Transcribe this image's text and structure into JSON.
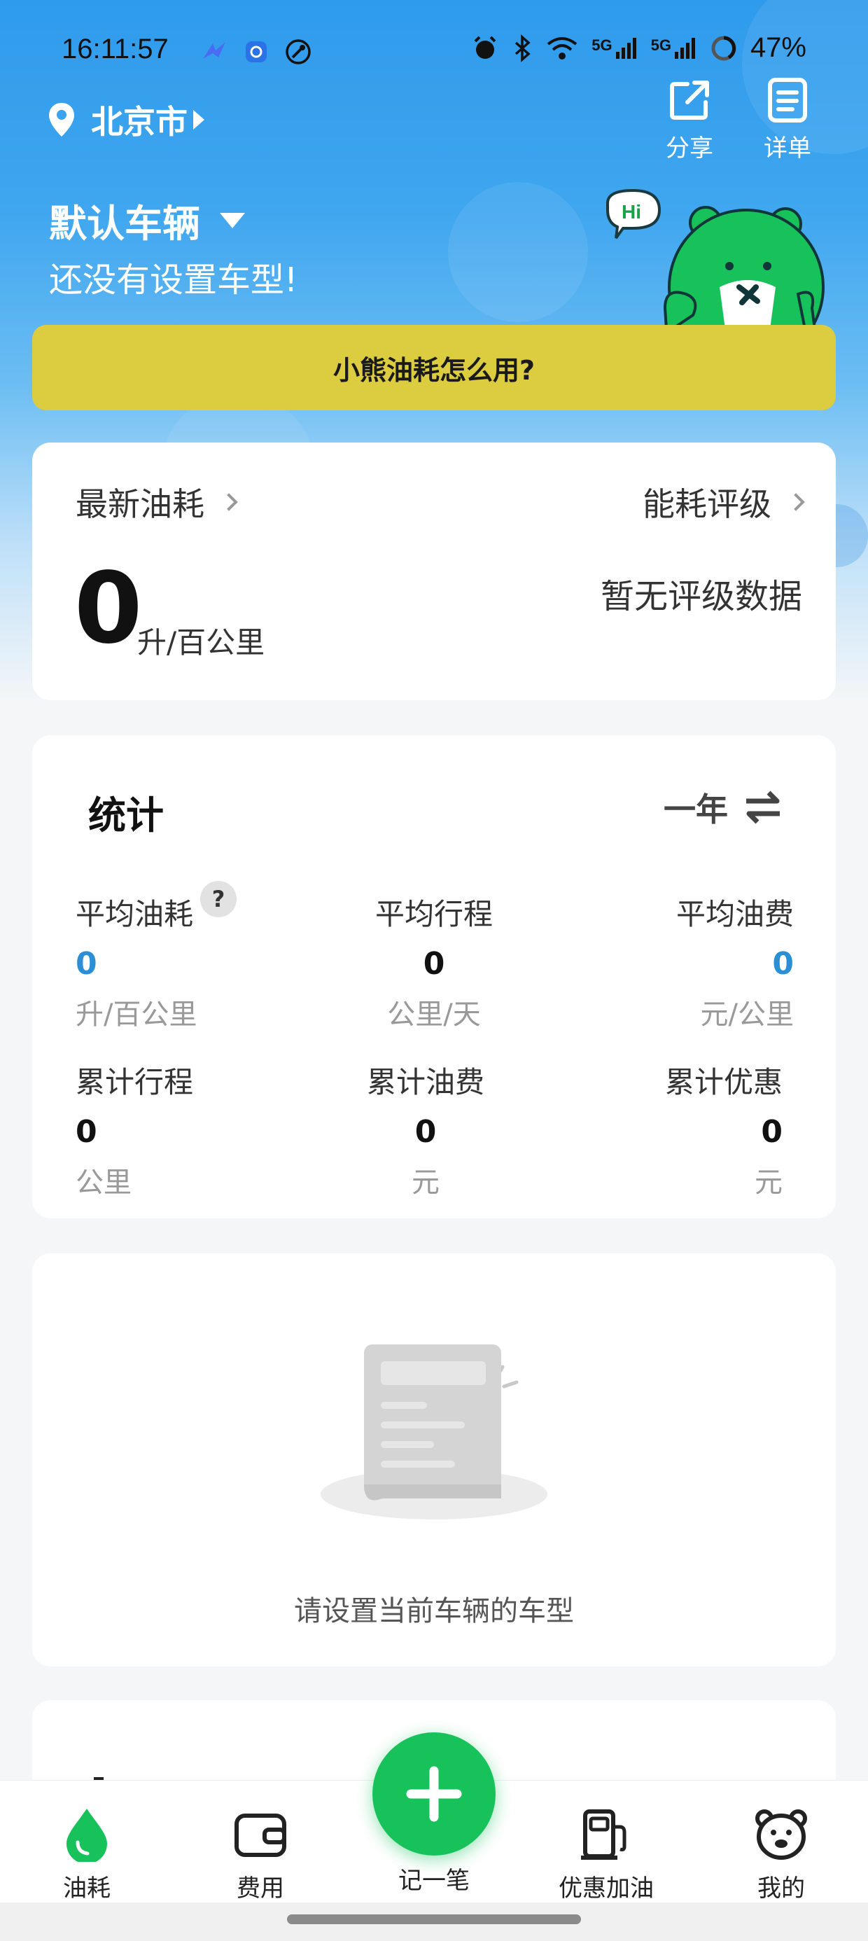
{
  "status_bar": {
    "time": "16:11:57",
    "network_1": "5G",
    "network_2": "5G",
    "battery": "47%"
  },
  "header": {
    "city": "北京市",
    "share_label": "分享",
    "detail_label": "详单",
    "vehicle_name": "默认车辆",
    "vehicle_hint": "还没有设置车型!",
    "mascot_greeting": "Hi"
  },
  "help_banner": {
    "label": "小熊油耗怎么用?"
  },
  "consumption_card": {
    "latest_label": "最新油耗",
    "rating_label": "能耗评级",
    "value": "0",
    "unit": "升/百公里",
    "rating_text": "暂无评级数据"
  },
  "stats_card": {
    "title": "统计",
    "period": "一年",
    "help_icon_text": "?",
    "items": [
      {
        "label": "平均油耗",
        "value": "0",
        "unit": "升/百公里"
      },
      {
        "label": "平均行程",
        "value": "0",
        "unit": "公里/天"
      },
      {
        "label": "平均油费",
        "value": "0",
        "unit": "元/公里"
      },
      {
        "label": "累计行程",
        "value": "0",
        "unit": "公里"
      },
      {
        "label": "累计油费",
        "value": "0",
        "unit": "元"
      },
      {
        "label": "累计优惠",
        "value": "0",
        "unit": "元"
      }
    ]
  },
  "empty_state": {
    "message": "请设置当前车辆的车型"
  },
  "bottom_nav": {
    "items": [
      {
        "label": "油耗",
        "icon": "drop-icon"
      },
      {
        "label": "费用",
        "icon": "wallet-icon"
      },
      {
        "label": "记一笔",
        "icon": "plus-icon"
      },
      {
        "label": "优惠加油",
        "icon": "fuel-pump-icon"
      },
      {
        "label": "我的",
        "icon": "bear-icon"
      }
    ]
  },
  "colors": {
    "brand_green": "#17c25a",
    "header_blue": "#2f9bec",
    "banner_yellow": "#dccc3f",
    "value_blue": "#2a8fd6"
  }
}
